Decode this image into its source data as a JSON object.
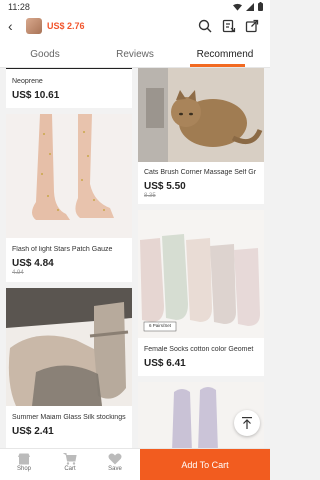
{
  "status_bar": {
    "time": "11:28"
  },
  "header": {
    "back_icon": "chevron-left-icon",
    "price": "US$ 2.76",
    "icons": [
      "search-icon",
      "favorite-list-icon",
      "share-icon"
    ]
  },
  "tabs": [
    {
      "label": "Goods",
      "active": false
    },
    {
      "label": "Reviews",
      "active": false
    },
    {
      "label": "Recommend",
      "active": true
    }
  ],
  "accent_color": "#f26a21",
  "products": [
    {
      "title": "Neoprene",
      "price": "US$ 10.61",
      "old_price": ""
    },
    {
      "title": "Cats Brush Corner  Massage Self Gr",
      "price": "US$ 5.50",
      "old_price": "8.35"
    },
    {
      "title": "Flash of light Stars Patch Gauze",
      "price": "US$ 4.84",
      "old_price": "4.94"
    },
    {
      "title": "Female Socks cotton color Geomet",
      "price": "US$ 6.41",
      "old_price": "",
      "image_tag": "6 Pairs/Set"
    },
    {
      "title": "Summer Maiam Glass Silk stockings",
      "price": "US$ 2.41",
      "old_price": ""
    }
  ],
  "bottom_nav": {
    "shop": "Shop",
    "cart": "Cart",
    "save": "Save",
    "add_to_cart": "Add To Cart"
  }
}
